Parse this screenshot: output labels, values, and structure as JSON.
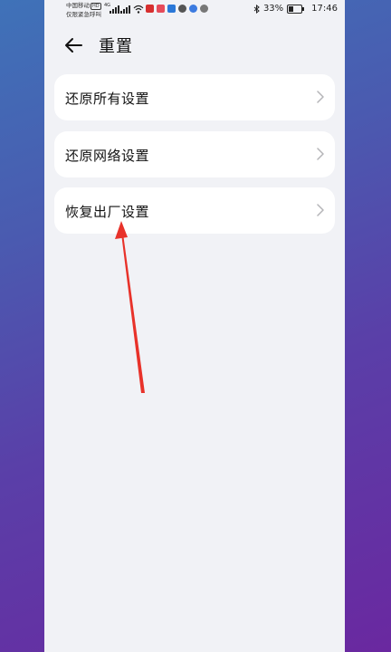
{
  "status_bar": {
    "carrier_line1": "中国移动",
    "carrier_badge": "HD",
    "carrier_line2": "仅限紧急呼叫",
    "network": "4G",
    "battery_percent": "33%",
    "battery_level": 0.33,
    "time": "17:46"
  },
  "header": {
    "title": "重置"
  },
  "menu": {
    "items": [
      {
        "label": "还原所有设置"
      },
      {
        "label": "还原网络设置"
      },
      {
        "label": "恢复出厂设置"
      }
    ]
  },
  "colors": {
    "page_background": "#f1f2f6",
    "card_background": "#ffffff",
    "annotation_arrow": "#e8322a"
  }
}
